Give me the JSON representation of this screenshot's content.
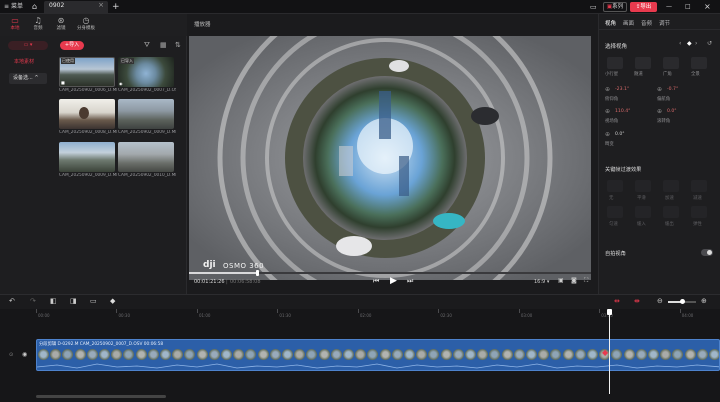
{
  "titlebar": {
    "menu_label": "菜单",
    "tab_name": "0902",
    "series_label": "系列",
    "export_label": "导出"
  },
  "media": {
    "tabs": [
      {
        "label": "本地",
        "icon": "folder-icon"
      },
      {
        "label": "音频",
        "icon": "music-icon"
      },
      {
        "label": "滤镜",
        "icon": "filter-icon"
      },
      {
        "label": "分身模板",
        "icon": "template-icon"
      }
    ],
    "import_label": "导入",
    "local_media_label": "本地素材",
    "device_label": "设备选...",
    "clips": [
      {
        "name": "CAM_20250902_0006_D.MP4",
        "badge": "已使用"
      },
      {
        "name": "CAM_20250902_0007_D.OSV",
        "badge": "已导入"
      },
      {
        "name": "CAM_20250902_0008_D.MP4",
        "badge": ""
      },
      {
        "name": "CAM_20250902_0009_D.MP4",
        "badge": ""
      },
      {
        "name": "CAM_20250902_0009_D.MP4",
        "badge": ""
      },
      {
        "name": "CAM_20250902_0010_D.MP4",
        "badge": ""
      }
    ]
  },
  "player": {
    "title": "播放器",
    "watermark": "OSMO 360",
    "dji_logo": "dji",
    "current_time": "00:01:21:26",
    "total_time": "00:06:58:08",
    "aspect": "16:9",
    "progress": 0.17
  },
  "props": {
    "tabs": [
      "视角",
      "画面",
      "音频",
      "调节"
    ],
    "section_view": "选择视角",
    "view_modes": [
      "小行星",
      "隧道",
      "广角",
      "全景"
    ],
    "params": [
      {
        "label": "俯仰角",
        "value": "-23.1°"
      },
      {
        "label": "偏航角",
        "value": "-0.7°"
      },
      {
        "label": "视场角",
        "value": "110.4°"
      },
      {
        "label": "滚转角",
        "value": "0.0°"
      },
      {
        "label": "畸变",
        "value": "0.0°"
      }
    ],
    "keyframe_section": "关键帧过渡效果",
    "keyframe_options": [
      "无",
      "平滑",
      "加速",
      "减速",
      "匀速",
      "缓入",
      "缓出",
      "弹性"
    ],
    "auto_view_label": "自拍视角"
  },
  "timeline": {
    "ticks": [
      "00:00",
      "00:30",
      "01:00",
      "01:30",
      "02:00",
      "02:30",
      "03:00",
      "03:30",
      "04:00"
    ],
    "clip_label": "分段剪辑 D-0292.M  CAM_20250902_0007_D.OSV 00:06:58",
    "playhead_fraction": 0.19
  },
  "colors": {
    "accent": "#e83a4e",
    "clip_blue": "#2c5fa8",
    "bg": "#1b1b1d"
  }
}
